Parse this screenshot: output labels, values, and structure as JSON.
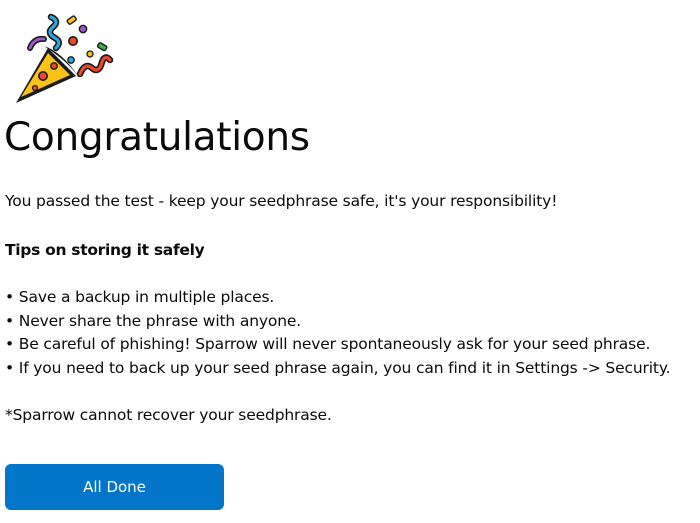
{
  "header": {
    "icon": "party-popper-icon",
    "title": "Congratulations"
  },
  "content": {
    "intro": "You passed the test - keep your seedphrase safe, it's your responsibility!",
    "tips_heading": "Tips on storing it safely",
    "tips": [
      "Save a backup in multiple places.",
      "Never share the phrase with anyone.",
      "Be careful of phishing! Sparrow will never spontaneously ask for your seed phrase.",
      "If you need to back up your seed phrase again, you can find it in Settings -> Security."
    ],
    "disclaimer": "*Sparrow cannot recover your seedphrase."
  },
  "actions": {
    "done_label": "All Done"
  },
  "colors": {
    "primary_button": "#0376c9",
    "button_text": "#ffffff",
    "text": "#0b0b0b",
    "background": "#ffffff"
  }
}
